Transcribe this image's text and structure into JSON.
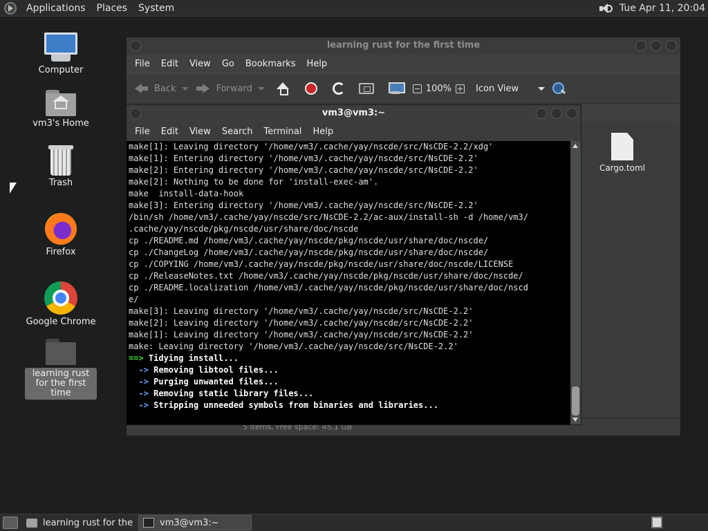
{
  "top_panel": {
    "menus": [
      "Applications",
      "Places",
      "System"
    ],
    "clock": "Tue Apr 11, 20:04"
  },
  "desktop": {
    "icons": [
      {
        "label": "Computer",
        "icon": "computer-icon"
      },
      {
        "label": "vm3's Home",
        "icon": "home-folder-icon"
      },
      {
        "label": "Trash",
        "icon": "trash-icon"
      },
      {
        "label": "Firefox",
        "icon": "firefox-icon"
      },
      {
        "label": "Google Chrome",
        "icon": "chrome-icon"
      },
      {
        "label": "learning rust for the first time",
        "icon": "folder-icon",
        "selected": true
      }
    ]
  },
  "file_manager": {
    "title": "learning rust for the first time",
    "menu": [
      "File",
      "Edit",
      "View",
      "Go",
      "Bookmarks",
      "Help"
    ],
    "toolbar": {
      "back_label": "Back",
      "forward_label": "Forward",
      "zoom": "100%",
      "view_mode": "Icon View"
    },
    "files": [
      {
        "name": "Cargo.toml",
        "icon": "document-icon"
      }
    ],
    "status": "5 items, Free space: 45.1 GB"
  },
  "terminal": {
    "title": "vm3@vm3:~",
    "menu": [
      "File",
      "Edit",
      "View",
      "Search",
      "Terminal",
      "Help"
    ],
    "lines": [
      "make[1]: Leaving directory '/home/vm3/.cache/yay/nscde/src/NsCDE-2.2/xdg'",
      "make[1]: Entering directory '/home/vm3/.cache/yay/nscde/src/NsCDE-2.2'",
      "make[2]: Entering directory '/home/vm3/.cache/yay/nscde/src/NsCDE-2.2'",
      "make[2]: Nothing to be done for 'install-exec-am'.",
      "make  install-data-hook",
      "make[3]: Entering directory '/home/vm3/.cache/yay/nscde/src/NsCDE-2.2'",
      "/bin/sh /home/vm3/.cache/yay/nscde/src/NsCDE-2.2/ac-aux/install-sh -d /home/vm3/",
      ".cache/yay/nscde/pkg/nscde/usr/share/doc/nscde",
      "cp ./README.md /home/vm3/.cache/yay/nscde/pkg/nscde/usr/share/doc/nscde/",
      "cp ./ChangeLog /home/vm3/.cache/yay/nscde/pkg/nscde/usr/share/doc/nscde/",
      "cp ./COPYING /home/vm3/.cache/yay/nscde/pkg/nscde/usr/share/doc/nscde/LICENSE",
      "cp ./ReleaseNotes.txt /home/vm3/.cache/yay/nscde/pkg/nscde/usr/share/doc/nscde/",
      "cp ./README.localization /home/vm3/.cache/yay/nscde/pkg/nscde/usr/share/doc/nscd",
      "e/",
      "make[3]: Leaving directory '/home/vm3/.cache/yay/nscde/src/NsCDE-2.2'",
      "make[2]: Leaving directory '/home/vm3/.cache/yay/nscde/src/NsCDE-2.2'",
      "make[1]: Leaving directory '/home/vm3/.cache/yay/nscde/src/NsCDE-2.2'",
      "make: Leaving directory '/home/vm3/.cache/yay/nscde/src/NsCDE-2.2'"
    ],
    "status_lines": [
      {
        "arrow": "==>",
        "text": " Tidying install...",
        "arrow_color": "#4ade3a"
      },
      {
        "arrow": "  ->",
        "text": " Removing libtool files...",
        "arrow_color": "#6aa5ff"
      },
      {
        "arrow": "  ->",
        "text": " Purging unwanted files...",
        "arrow_color": "#6aa5ff"
      },
      {
        "arrow": "  ->",
        "text": " Removing static library files...",
        "arrow_color": "#6aa5ff"
      },
      {
        "arrow": "  ->",
        "text": " Stripping unneeded symbols from binaries and libraries...",
        "arrow_color": "#6aa5ff"
      }
    ]
  },
  "bottom_panel": {
    "tasks": [
      {
        "label": "learning rust for the ...",
        "icon": "folder-icon",
        "active": false
      },
      {
        "label": "vm3@vm3:~",
        "icon": "terminal-icon",
        "active": true
      }
    ]
  }
}
